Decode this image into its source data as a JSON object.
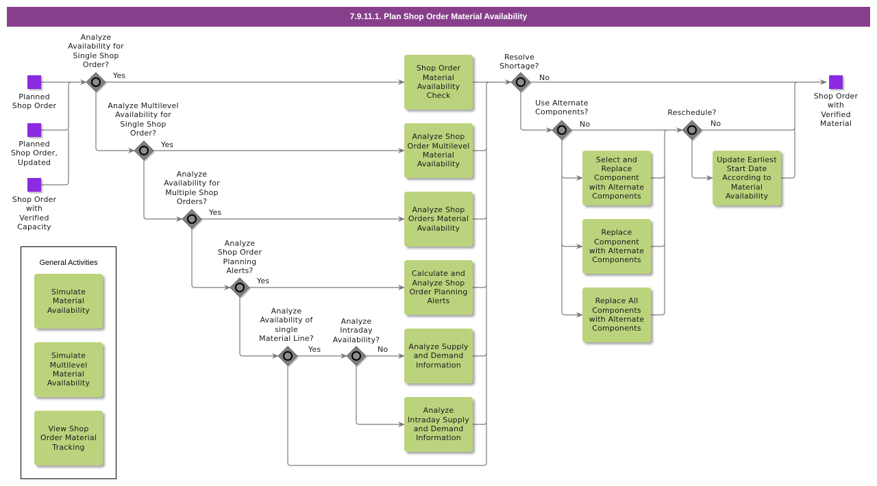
{
  "title": "7.9.11.1. Plan Shop Order Material Availability",
  "colors": {
    "title_bar": "#873f8b",
    "task_fill": "#bcd37d",
    "event_fill": "#8a2be2",
    "gateway_fill": "#7f7f7f",
    "connector": "#7a7a7a"
  },
  "start_events": [
    {
      "id": "planned-shop-order",
      "label": "Planned\nShop Order"
    },
    {
      "id": "planned-shop-order-updated",
      "label": "Planned\nShop Order,\nUpdated"
    },
    {
      "id": "shop-order-verified-capacity",
      "label": "Shop Order\nwith\nVerified\nCapacity"
    }
  ],
  "end_event": {
    "id": "shop-order-verified-material",
    "label": "Shop Order\nwith\nVerified\nMaterial"
  },
  "gateways": [
    {
      "id": "g1",
      "question": "Analyze\nAvailability for\nSingle Shop\nOrder?",
      "out_label": "Yes"
    },
    {
      "id": "g2",
      "question": "Analyze Multilevel\nAvailability for\nSingle Shop\nOrder?",
      "out_label": "Yes"
    },
    {
      "id": "g3",
      "question": "Analyze\nAvailability for\nMultiple Shop\nOrders?",
      "out_label": "Yes"
    },
    {
      "id": "g4",
      "question": "Analyze\nShop Order\nPlanning\nAlerts?",
      "out_label": "Yes"
    },
    {
      "id": "g5",
      "question": "Analyze\nAvailability of\nsingle\nMaterial Line?",
      "out_label": "Yes"
    },
    {
      "id": "g6",
      "question": "Analyze\nIntraday\nAvailability?",
      "out_label": "No"
    },
    {
      "id": "g7",
      "question": "Resolve\nShortage?",
      "out_label": "No"
    },
    {
      "id": "g8",
      "question": "Use Alternate\nComponents?",
      "out_label": "No"
    },
    {
      "id": "g9",
      "question": "Reschedule?",
      "out_label": "No"
    }
  ],
  "tasks": [
    {
      "id": "t1",
      "label": "Shop Order Material Availability Check"
    },
    {
      "id": "t2",
      "label": "Analyze Shop Order Multilevel Material Availability"
    },
    {
      "id": "t3",
      "label": "Analyze Shop Orders Material Availability"
    },
    {
      "id": "t4",
      "label": "Calculate and Analyze Shop Order Planning Alerts"
    },
    {
      "id": "t5",
      "label": "Analyze Supply and Demand Information"
    },
    {
      "id": "t6",
      "label": "Analyze Intraday Supply and Demand Information"
    },
    {
      "id": "t7",
      "label": "Select and Replace Component with Alternate Components"
    },
    {
      "id": "t8",
      "label": "Replace Component with Alternate Components"
    },
    {
      "id": "t9",
      "label": "Replace All Components with Alternate Components"
    },
    {
      "id": "t10",
      "label": "Update Earliest Start Date According to Material Availability"
    }
  ],
  "general_activities": {
    "title": "General Activities",
    "items": [
      {
        "label": "Simulate Material Availability"
      },
      {
        "label": "Simulate Multilevel Material Availability"
      },
      {
        "label": "View Shop Order Material Tracking"
      }
    ]
  }
}
